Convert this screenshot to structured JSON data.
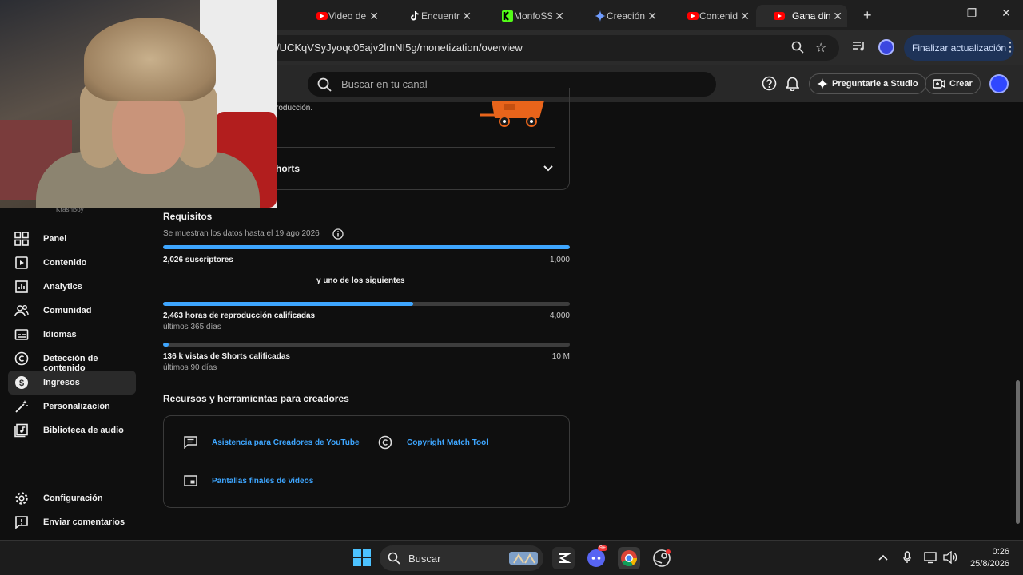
{
  "browser": {
    "tabs": [
      {
        "title": "Video de"
      },
      {
        "title": "Encuentra"
      },
      {
        "title": "MonfoSSE"
      },
      {
        "title": "Creación"
      },
      {
        "title": "Contenido"
      },
      {
        "title": "Gana dine"
      }
    ],
    "url": "/UCKqVSyJyoqc05ajv2lmNI5g/monetization/overview",
    "update_button": "Finalizar actualización"
  },
  "studio_header": {
    "search_placeholder": "Buscar en tu canal",
    "ask_studio": "Preguntarle a Studio",
    "create": "Crear"
  },
  "sidebar": {
    "channel_name": "KrashBoy",
    "items": [
      {
        "label": "Panel"
      },
      {
        "label": "Contenido"
      },
      {
        "label": "Analytics"
      },
      {
        "label": "Comunidad"
      },
      {
        "label": "Idiomas"
      },
      {
        "label": "Detección de contenido"
      },
      {
        "label": "Ingresos"
      },
      {
        "label": "Personalización"
      },
      {
        "label": "Biblioteca de audio"
      }
    ],
    "bottom": [
      {
        "label": "Configuración"
      },
      {
        "label": "Enviar comentarios"
      }
    ]
  },
  "main": {
    "top_card": {
      "description_fragment": "roducción.",
      "shorts_fragment": "horts"
    },
    "requirements": {
      "title": "Requisitos",
      "data_note": "Se muestran los datos hasta el 19 ago 2026",
      "subscribers": {
        "label": "2,026 suscriptores",
        "goal": "1,000",
        "progress": 1.0
      },
      "one_of": "y uno de los siguientes",
      "watch_hours": {
        "label": "2,463 horas de reproducción calificadas",
        "period": "últimos 365 días",
        "goal": "4,000",
        "progress": 0.6158
      },
      "shorts_views": {
        "label": "136 k vistas de Shorts calificadas",
        "period": "últimos 90 días",
        "goal": "10 M",
        "progress": 0.0136
      }
    },
    "resources": {
      "title": "Recursos y herramientas para creadores",
      "links": [
        {
          "label": "Asistencia para Creadores de YouTube"
        },
        {
          "label": "Copyright Match Tool"
        },
        {
          "label": "Pantallas finales de videos"
        }
      ]
    }
  },
  "taskbar": {
    "search_label": "Buscar",
    "time": "0:26",
    "date": "25/8/2026",
    "badge_discord": "9+"
  },
  "colors": {
    "accent": "#3ea6ff",
    "background": "#0f0f0f",
    "header": "#282828"
  }
}
